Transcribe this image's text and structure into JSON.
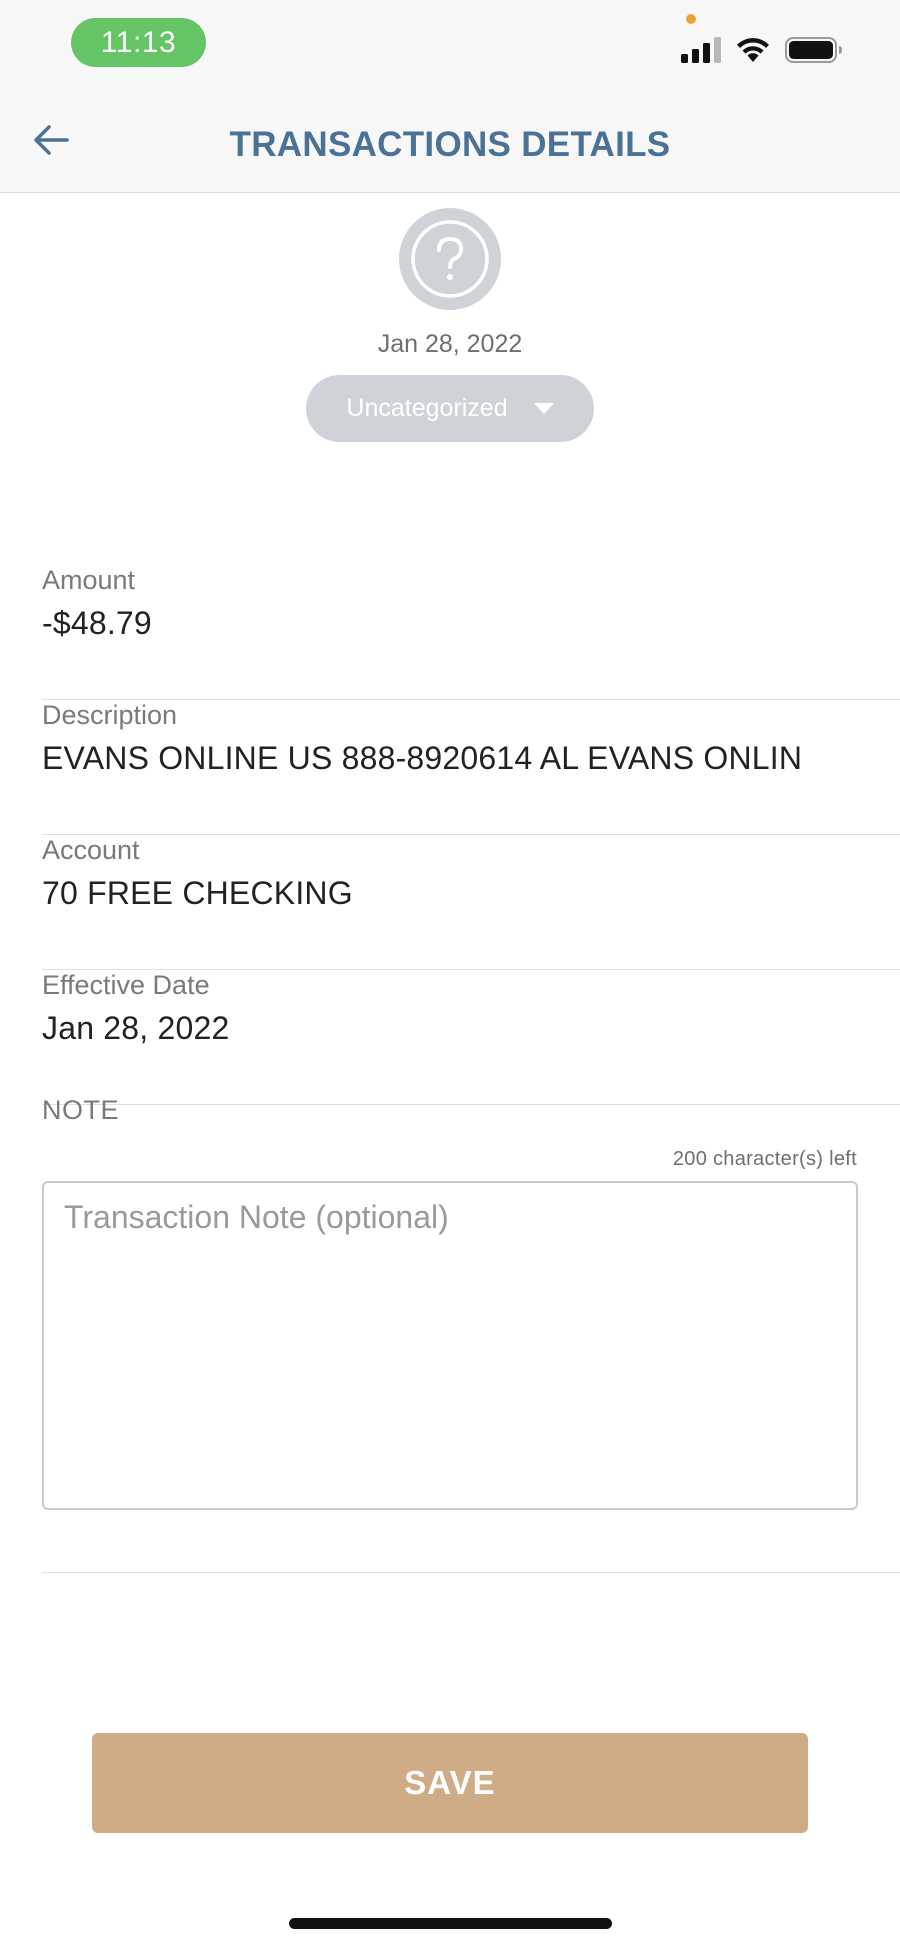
{
  "status_bar": {
    "time": "11:13",
    "icons": [
      "cellular-signal-icon",
      "wifi-icon",
      "battery-icon"
    ],
    "time_pill_color": "#65c466"
  },
  "header": {
    "title": "TRANSACTIONS DETAILS",
    "back_icon": "arrow-left-icon",
    "title_color": "#4a7296"
  },
  "transaction": {
    "category_icon": "question-mark-icon",
    "date": "Jan 28, 2022",
    "category": "Uncategorized"
  },
  "fields": [
    {
      "label": "Amount",
      "value": "-$48.79"
    },
    {
      "label": "Description",
      "value": "EVANS ONLINE US 888-8920614 AL EVANS ONLIN"
    },
    {
      "label": "Account",
      "value": "70 FREE CHECKING"
    },
    {
      "label": "Effective Date",
      "value": "Jan 28, 2022"
    }
  ],
  "note": {
    "label": "NOTE",
    "chars_left": "200 character(s) left",
    "placeholder": "Transaction Note (optional)",
    "value": ""
  },
  "save": {
    "label": "SAVE",
    "color": "#cfac86"
  }
}
